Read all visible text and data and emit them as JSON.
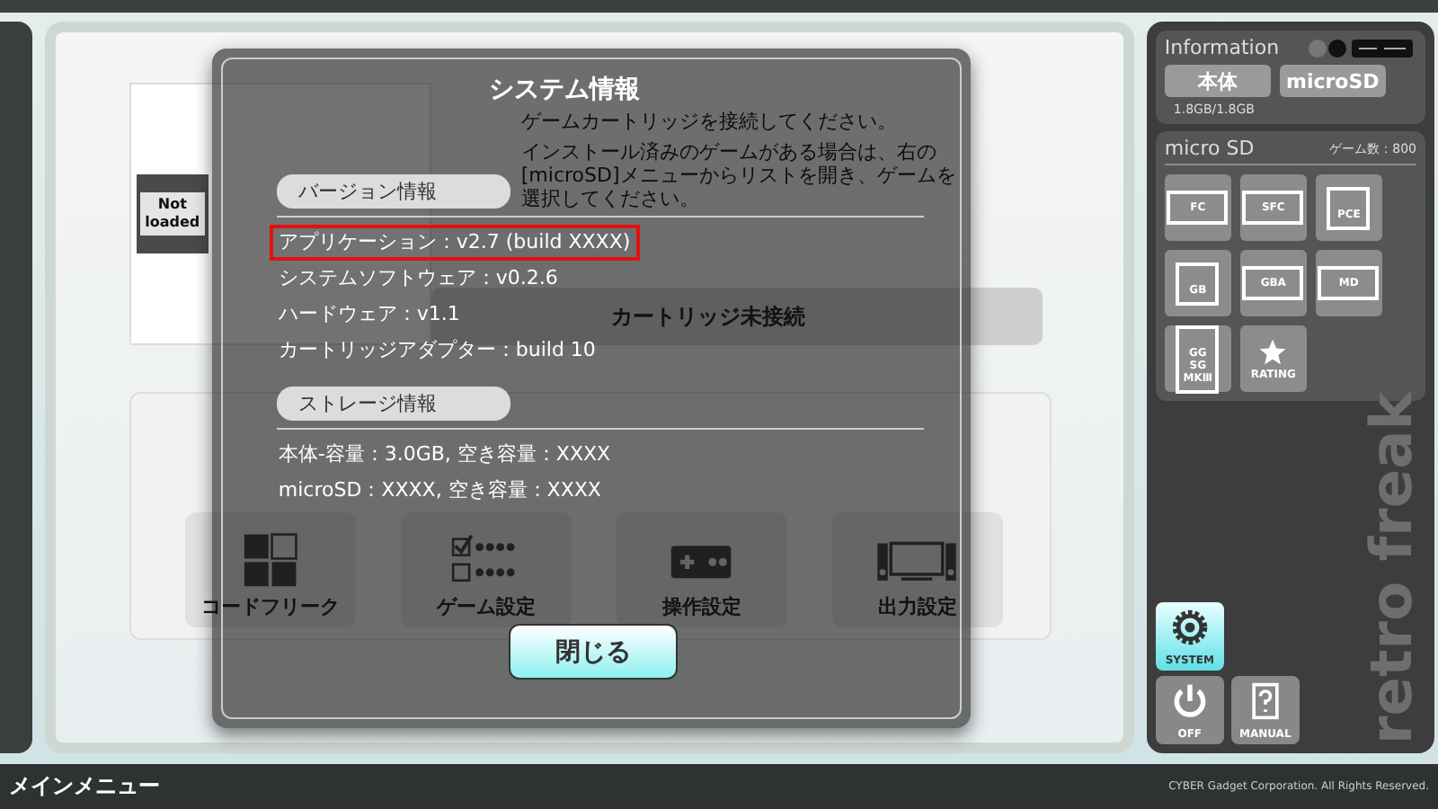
{
  "main_menu": {
    "cartridge_label": "Not loaded",
    "message": [
      "ゲームカートリッジを接続してください。",
      "インストール済みのゲームがある場合は、右の[microSD]メニューからリストを開き、ゲームを選択してください。"
    ],
    "cartridge_status": "カートリッジ未接続",
    "tiles": [
      {
        "label": "コードフリーク",
        "kind": "grid"
      },
      {
        "label": "ゲーム設定",
        "kind": "checklist"
      },
      {
        "label": "操作設定",
        "kind": "controller"
      },
      {
        "label": "出力設定",
        "kind": "display"
      }
    ]
  },
  "dialog": {
    "title": "システム情報",
    "sections": [
      {
        "heading": "バージョン情報",
        "lines": [
          {
            "text": "アプリケーション：v2.7 (build XXXX)",
            "highlighted": true
          },
          {
            "text": "システムソフトウェア：v0.2.6",
            "highlighted": false
          },
          {
            "text": "ハードウェア：v1.1",
            "highlighted": false
          },
          {
            "text": "カートリッジアダプター：build 10",
            "highlighted": false
          }
        ]
      },
      {
        "heading": "ストレージ情報",
        "lines": [
          {
            "text": "本体-容量：3.0GB, 空き容量：XXXX",
            "highlighted": false
          },
          {
            "text": "microSD：XXXX, 空き容量：XXXX",
            "highlighted": false
          }
        ]
      }
    ],
    "close_button": "閉じる"
  },
  "sidebar": {
    "info_title": "Information",
    "storage_tabs": [
      "本体",
      "microSD"
    ],
    "capacity": "1.8GB/1.8GB",
    "sd_title": "micro SD",
    "game_count": "ゲーム数：800",
    "systems": [
      {
        "label": "FC",
        "kind": "cart"
      },
      {
        "label": "SFC",
        "kind": "cart"
      },
      {
        "label": "PCE",
        "kind": "card"
      },
      {
        "label": "GB",
        "kind": "card"
      },
      {
        "label": "GBA",
        "kind": "cart"
      },
      {
        "label": "MD",
        "kind": "cart"
      },
      {
        "label": "GG SG MKⅢ",
        "kind": "card"
      },
      {
        "label": "RATING",
        "kind": "star"
      }
    ],
    "buttons": [
      {
        "label": "SYSTEM",
        "kind": "gear",
        "selected": true
      },
      {
        "label": "OFF",
        "kind": "power",
        "selected": false
      },
      {
        "label": "MANUAL",
        "kind": "manual",
        "selected": false
      }
    ],
    "logo": "retro freak"
  },
  "footer": {
    "title": "メインメニュー",
    "copyright": "CYBER Gadget Corporation. All Rights Reserved."
  }
}
